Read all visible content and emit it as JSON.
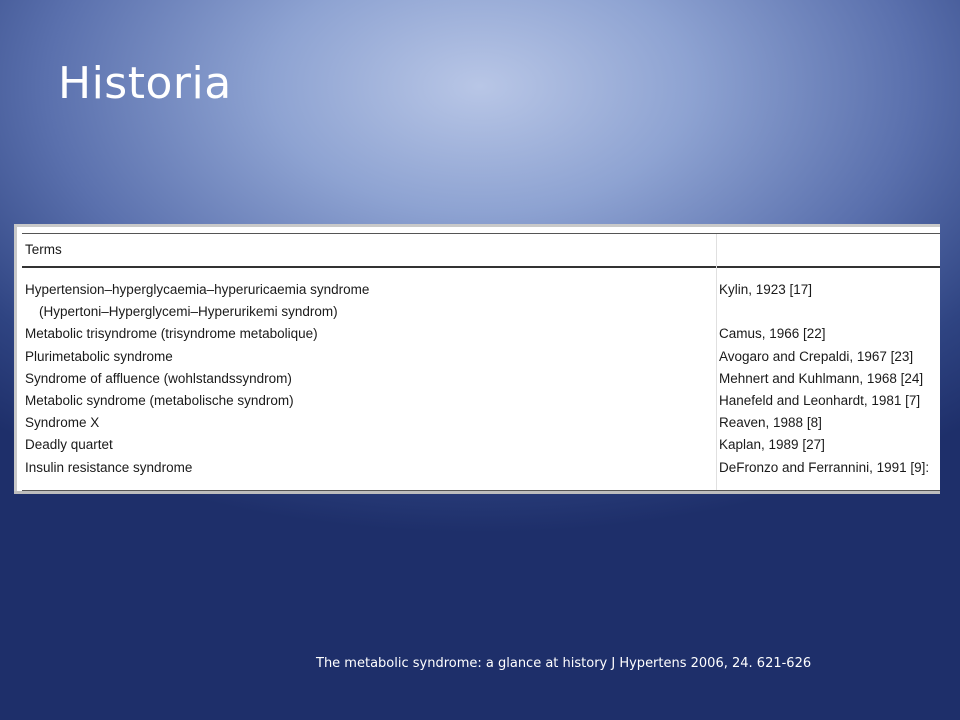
{
  "slide": {
    "title": "Historia",
    "citation": "The metabolic syndrome: a glance at history J Hypertens 2006, 24. 621-626"
  },
  "table": {
    "header": {
      "term": "Terms"
    },
    "rows": [
      {
        "term": "Hypertension–hyperglycaemia–hyperuricaemia syndrome",
        "ref": "Kylin, 1923 [17]"
      },
      {
        "term": "(Hypertoni–Hyperglycemi–Hyperurikemi syndrom)",
        "ref": ""
      },
      {
        "term": "Metabolic trisyndrome (trisyndrome metabolique)",
        "ref": "Camus, 1966 [22]"
      },
      {
        "term": "Plurimetabolic syndrome",
        "ref": "Avogaro and Crepaldi, 1967 [23]"
      },
      {
        "term": "Syndrome of affluence (wohlstandssyndrom)",
        "ref": "Mehnert and Kuhlmann, 1968 [24]"
      },
      {
        "term": "Metabolic syndrome (metabolische syndrom)",
        "ref": "Hanefeld and Leonhardt, 1981 [7]"
      },
      {
        "term": "Syndrome X",
        "ref": "Reaven, 1988 [8]"
      },
      {
        "term": "Deadly quartet",
        "ref": "Kaplan, 1989 [27]"
      },
      {
        "term": "Insulin resistance syndrome",
        "ref": "DeFronzo and Ferrannini, 1991 [9]:"
      }
    ]
  }
}
